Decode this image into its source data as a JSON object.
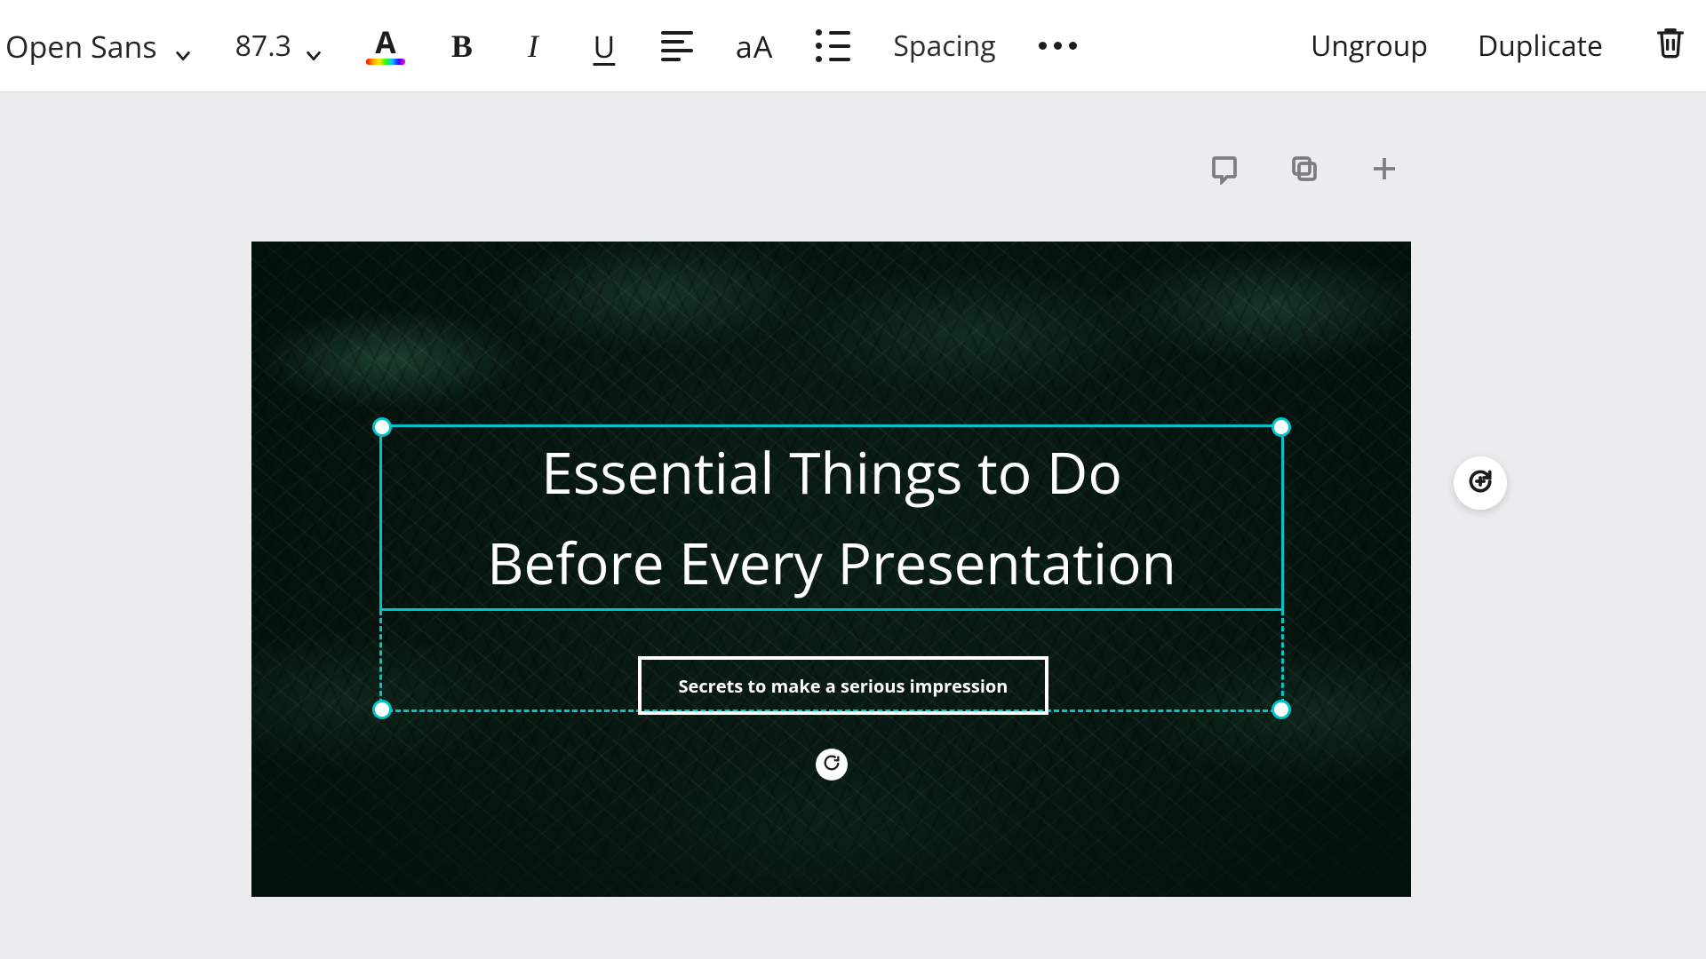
{
  "toolbar": {
    "font": "Open Sans",
    "size": "87.3",
    "spacing_label": "Spacing",
    "ungroup_label": "Ungroup",
    "duplicate_label": "Duplicate"
  },
  "slide": {
    "title": "Essential Things to Do\nBefore Every Presentation",
    "subtitle": "Secrets to make a serious impression"
  }
}
